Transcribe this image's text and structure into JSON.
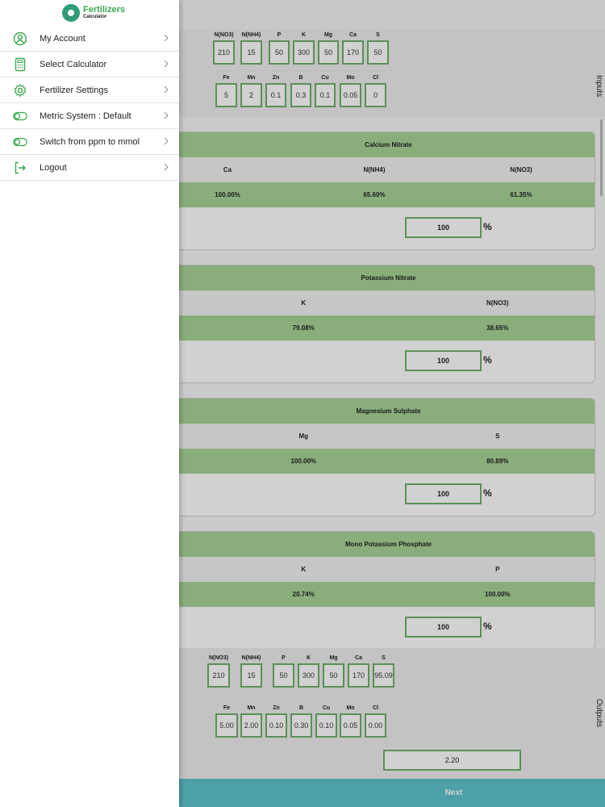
{
  "app": {
    "logo_line1": "Fertilizers",
    "logo_line2": "Calculator",
    "accent_color": "#3aa84d"
  },
  "menu": {
    "items": [
      {
        "label": "My Account",
        "icon": "user-circle-icon"
      },
      {
        "label": "Select Calculator",
        "icon": "calculator-icon"
      },
      {
        "label": "Fertilizer Settings",
        "icon": "gear-icon"
      },
      {
        "label": "Metric System : Default",
        "icon": "toggle-icon"
      },
      {
        "label": "Switch from ppm to mmol",
        "icon": "toggle-icon"
      },
      {
        "label": "Logout",
        "icon": "logout-icon"
      }
    ]
  },
  "inputs": {
    "side_label": "Inputs",
    "row1": [
      {
        "label": "N(NO3)",
        "value": "210"
      },
      {
        "label": "N(NH4)",
        "value": "15"
      },
      {
        "label": "P",
        "value": "50"
      },
      {
        "label": "K",
        "value": "300"
      },
      {
        "label": "Mg",
        "value": "50"
      },
      {
        "label": "Ca",
        "value": "170"
      },
      {
        "label": "S",
        "value": "50"
      }
    ],
    "row2": [
      {
        "label": "Fe",
        "value": "5"
      },
      {
        "label": "Mn",
        "value": "2"
      },
      {
        "label": "Zn",
        "value": "0.1"
      },
      {
        "label": "B",
        "value": "0.3"
      },
      {
        "label": "Cu",
        "value": "0.1"
      },
      {
        "label": "Mo",
        "value": "0.05"
      },
      {
        "label": "Cl",
        "value": "0"
      }
    ]
  },
  "fertilizers": [
    {
      "name": "Calcium Nitrate",
      "headers": [
        "Ca",
        "N(NH4)",
        "N(NO3)"
      ],
      "values": [
        "100.00%",
        "65.60%",
        "61.35%"
      ],
      "percent": "100",
      "unit": "%"
    },
    {
      "name": "Potassium Nitrate",
      "headers": [
        "K",
        "N(NO3)"
      ],
      "values": [
        "79.08%",
        "38.65%"
      ],
      "percent": "100",
      "unit": "%"
    },
    {
      "name": "Magnesium Sulphate",
      "headers": [
        "Mg",
        "S"
      ],
      "values": [
        "100.00%",
        "80.89%"
      ],
      "percent": "100",
      "unit": "%"
    },
    {
      "name": "Mono Potassium Phosphate",
      "headers": [
        "K",
        "P"
      ],
      "values": [
        "20.74%",
        "100.00%"
      ],
      "percent": "100",
      "unit": "%"
    }
  ],
  "outputs": {
    "side_label": "Outputs",
    "row1": [
      {
        "label": "N(NO3)",
        "value": "210"
      },
      {
        "label": "N(NH4)",
        "value": "15"
      },
      {
        "label": "P",
        "value": "50"
      },
      {
        "label": "K",
        "value": "300"
      },
      {
        "label": "Mg",
        "value": "50"
      },
      {
        "label": "Ca",
        "value": "170"
      },
      {
        "label": "S",
        "value": "95.09"
      }
    ],
    "row2": [
      {
        "label": "Fe",
        "value": "5.00"
      },
      {
        "label": "Mn",
        "value": "2.00"
      },
      {
        "label": "Zn",
        "value": "0.10"
      },
      {
        "label": "B",
        "value": "0.30"
      },
      {
        "label": "Cu",
        "value": "0.10"
      },
      {
        "label": "Mo",
        "value": "0.05"
      },
      {
        "label": "Cl",
        "value": "0.00"
      }
    ],
    "ratio": "2.20"
  },
  "footer": {
    "next_label": "Next"
  }
}
